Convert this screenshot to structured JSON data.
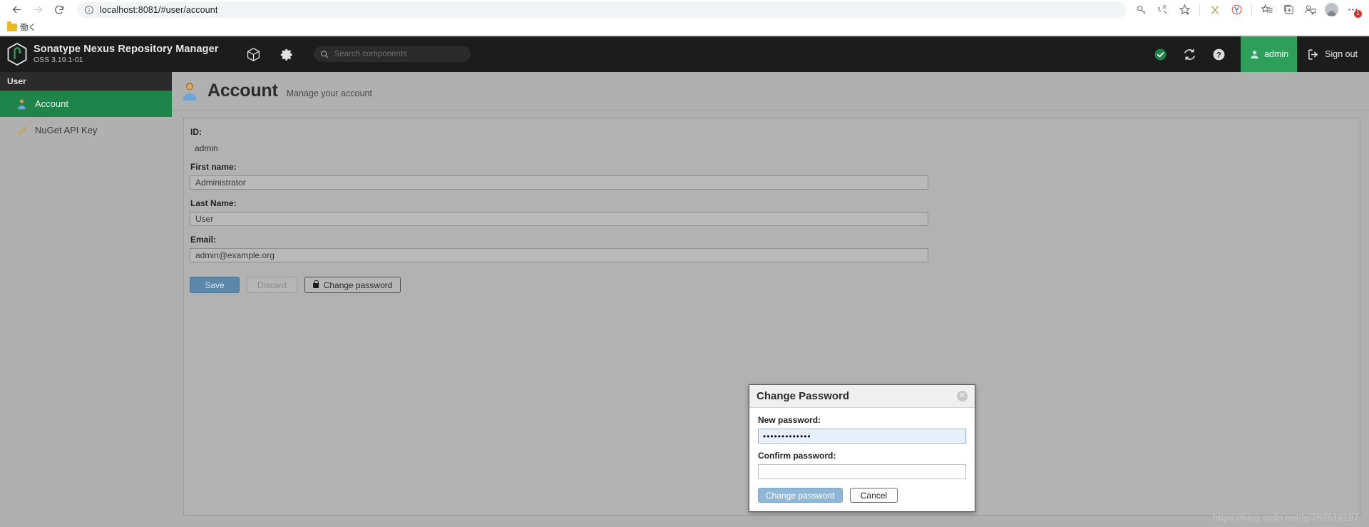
{
  "browser": {
    "back_label": "Back",
    "forward_label": "Forward",
    "reload_label": "Reload",
    "url_prefix": "localhost",
    "url_suffix": ":8081/#user/account",
    "url_full": "localhost:8081/#user/account",
    "info_icon": "info-circle-icon",
    "toolbar_icons": [
      {
        "name": "password-key-icon",
        "glyph": "key"
      },
      {
        "name": "translate-icon",
        "glyph": "translate"
      },
      {
        "name": "favorite-star-icon",
        "glyph": "star-plus"
      },
      {
        "name": "extension-x-icon",
        "glyph": "x-ext"
      },
      {
        "name": "yandex-extension-icon",
        "glyph": "y-circle"
      },
      {
        "name": "collections-favorites-icon",
        "glyph": "star-list"
      },
      {
        "name": "collections-icon",
        "glyph": "collections"
      },
      {
        "name": "browser-essentials-icon",
        "glyph": "profile-add"
      },
      {
        "name": "profile-avatar-icon",
        "glyph": "avatar"
      },
      {
        "name": "settings-more-icon",
        "glyph": "ellipsis",
        "badge": "1"
      }
    ],
    "bookmarks": [
      {
        "name": "bookmark-folder-work",
        "label": "働く"
      }
    ]
  },
  "header": {
    "brand_title": "Sonatype Nexus Repository Manager",
    "brand_version": "OSS 3.19.1-01",
    "logo_icon": "nexus-hexagon-logo",
    "browse_icon": "cube-browse-icon",
    "admin_icon": "gear-admin-icon",
    "search": {
      "placeholder": "Search components",
      "value": "",
      "icon": "search-icon"
    },
    "status": {
      "health_icon": "green-check-status-icon",
      "health_color": "#1e8449",
      "refresh_icon": "refresh-icon",
      "help_icon": "help-circle-icon"
    },
    "user_tab": {
      "label": "admin",
      "icon": "user-avatar-icon",
      "active_color": "#2e9e5b"
    },
    "sign_out": {
      "label": "Sign out",
      "icon": "sign-out-icon"
    }
  },
  "sidebar": {
    "title": "User",
    "items": [
      {
        "label": "Account",
        "icon": "user-account-icon",
        "active": true
      },
      {
        "label": "NuGet API Key",
        "icon": "key-icon",
        "active": false
      }
    ]
  },
  "page": {
    "icon": "user-account-icon",
    "title": "Account",
    "subtitle": "Manage your account"
  },
  "form": {
    "id_label": "ID:",
    "id_value": "admin",
    "first_name_label": "First name:",
    "first_name_value": "Administrator",
    "last_name_label": "Last Name:",
    "last_name_value": "User",
    "email_label": "Email:",
    "email_value": "admin@example.org",
    "buttons": {
      "save": "Save",
      "discard": "Discard",
      "change_password": "Change password",
      "change_password_icon": "lock-icon",
      "save_color": "#5b87ab"
    }
  },
  "modal": {
    "title": "Change Password",
    "close_icon": "close-circle-icon",
    "new_password_label": "New password:",
    "new_password_value": "•••••••••••••",
    "confirm_password_label": "Confirm password:",
    "confirm_password_value": "",
    "submit_label": "Change password",
    "cancel_label": "Cancel",
    "submit_color": "#90b8d6"
  },
  "watermark": "https://blog.csdn.net/lgl782519197"
}
